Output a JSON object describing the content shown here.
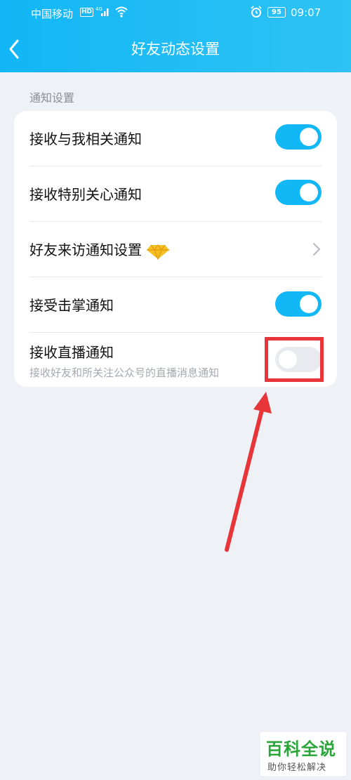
{
  "status_bar": {
    "carrier": "中国移动",
    "hd": "HD",
    "network": "4G",
    "battery": "95",
    "time": "09:07"
  },
  "header": {
    "title": "好友动态设置",
    "back_icon": "chevron-left-icon"
  },
  "section": {
    "label": "通知设置"
  },
  "settings": [
    {
      "label": "接收与我相关通知",
      "control": "toggle",
      "on": true
    },
    {
      "label": "接收特别关心通知",
      "control": "toggle",
      "on": true
    },
    {
      "label": "好友来访通知设置",
      "control": "chevron",
      "icon": "diamond-icon"
    },
    {
      "label": "接受击掌通知",
      "control": "toggle",
      "on": true
    },
    {
      "label": "接收直播通知",
      "sublabel": "接收好友和所关注公众号的直播消息通知",
      "control": "toggle",
      "on": false
    }
  ],
  "colors": {
    "header": "#12b6f6",
    "toggle_on": "#12b7f5",
    "toggle_off": "#e8eaef",
    "annotation": "#e8353a",
    "watermark": "#2aa53a"
  },
  "watermark": {
    "main": "百科全说",
    "sub": "助你轻松解决"
  }
}
